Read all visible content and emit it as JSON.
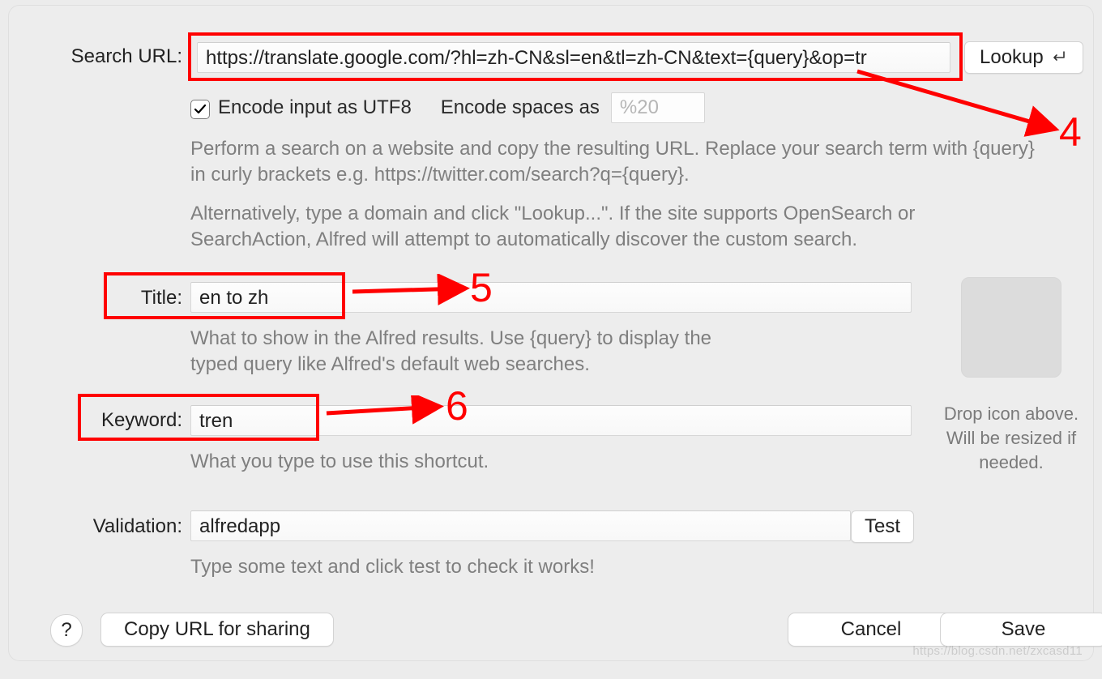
{
  "labels": {
    "search_url": "Search URL:",
    "title": "Title:",
    "keyword": "Keyword:",
    "validation": "Validation:"
  },
  "search_url": {
    "value": "https://translate.google.com/?hl=zh-CN&sl=en&tl=zh-CN&text={query}&op=tr",
    "lookup_label": "Lookup"
  },
  "utf8": {
    "checked": true,
    "label": "Encode input as UTF8",
    "spaces_label": "Encode spaces as",
    "spaces_placeholder": "%20"
  },
  "help": {
    "p1": "Perform a search on a website and copy the resulting URL. Replace your search term with {query} in curly brackets e.g. https://twitter.com/search?q={query}.",
    "p2": "Alternatively, type a domain and click \"Lookup...\". If the site supports OpenSearch or SearchAction, Alfred will attempt to automatically discover the custom search."
  },
  "title": {
    "value": "en to zh",
    "help": "What to show in the Alfred results. Use {query} to display the typed query like Alfred's default web searches."
  },
  "keyword": {
    "value": "tren",
    "help": "What you type to use this shortcut."
  },
  "validation": {
    "value": "alfredapp",
    "test_label": "Test",
    "help": "Type some text and click test to check it works!"
  },
  "icon_drop": {
    "caption": "Drop icon above. Will be resized if needed."
  },
  "footer": {
    "help": "?",
    "copy": "Copy URL for sharing",
    "cancel": "Cancel",
    "save": "Save"
  },
  "annotations": {
    "n4": "4",
    "n5": "5",
    "n6": "6"
  },
  "watermark": "https://blog.csdn.net/zxcasd11"
}
